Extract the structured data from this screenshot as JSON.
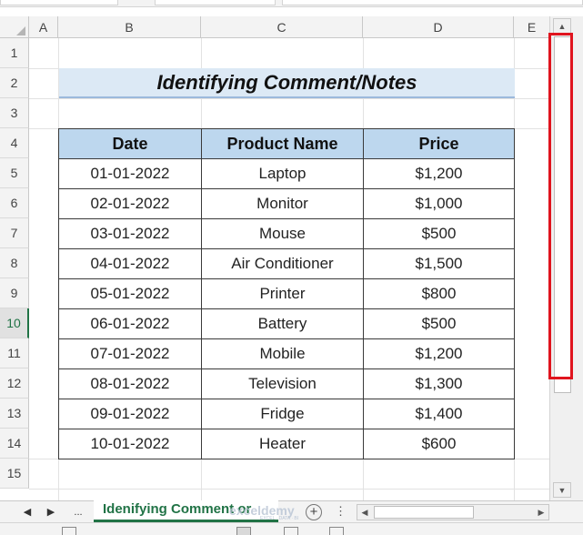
{
  "columns": [
    "A",
    "B",
    "C",
    "D",
    "E"
  ],
  "rows": [
    "1",
    "2",
    "3",
    "4",
    "5",
    "6",
    "7",
    "8",
    "9",
    "10",
    "11",
    "12",
    "13",
    "14",
    "15"
  ],
  "selected_row": "10",
  "title": "Identifying Comment/Notes",
  "table": {
    "headers": [
      "Date",
      "Product Name",
      "Price"
    ],
    "rows": [
      [
        "01-01-2022",
        "Laptop",
        "$1,200"
      ],
      [
        "02-01-2022",
        "Monitor",
        "$1,000"
      ],
      [
        "03-01-2022",
        "Mouse",
        "$500"
      ],
      [
        "04-01-2022",
        "Air Conditioner",
        "$1,500"
      ],
      [
        "05-01-2022",
        "Printer",
        "$800"
      ],
      [
        "06-01-2022",
        "Battery",
        "$500"
      ],
      [
        "07-01-2022",
        "Mobile",
        "$1,200"
      ],
      [
        "08-01-2022",
        "Television",
        "$1,300"
      ],
      [
        "09-01-2022",
        "Fridge",
        "$1,400"
      ],
      [
        "10-01-2022",
        "Heater",
        "$600"
      ]
    ]
  },
  "sheet_tabs": {
    "prev_icon": "◀",
    "next_icon": "▶",
    "ellipsis": "...",
    "active_tab": "Idenifying Comment or",
    "add_icon": "+",
    "more": "⋮"
  },
  "watermark": {
    "name": "exceldemy",
    "tagline": "EXCEL · DATA · BI"
  },
  "scroll": {
    "up_icon": "▲",
    "down_icon": "▼",
    "left_icon": "◀",
    "right_icon": "▶"
  },
  "colors": {
    "accent_green": "#217346",
    "header_fill": "#bdd7ee",
    "title_fill": "#dce9f5",
    "highlight_red": "#e0141e"
  }
}
